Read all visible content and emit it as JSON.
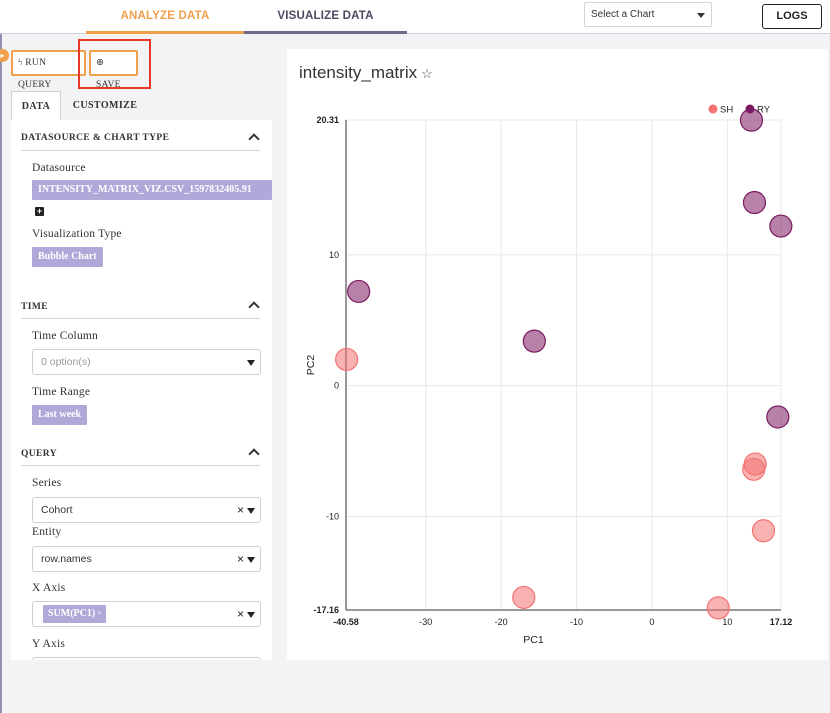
{
  "header": {
    "tabs": [
      {
        "label": "ANALYZE DATA",
        "active": true
      },
      {
        "label": "VISUALIZE DATA",
        "active": false
      }
    ],
    "chart_select": {
      "value": "Select a Chart"
    },
    "logs_label": "LOGS"
  },
  "toolbar": {
    "run_query_label": "RUN QUERY",
    "save_label": "SAVE"
  },
  "panel_tabs": [
    {
      "label": "DATA",
      "active": true
    },
    {
      "label": "CUSTOMIZE",
      "active": false
    }
  ],
  "sections": {
    "datasource": {
      "title": "DATASOURCE & CHART TYPE",
      "datasource_label": "Datasource",
      "datasource_value": "INTENSITY_MATRIX_VIZ.CSV_1597832405.91",
      "viz_type_label": "Visualization Type",
      "viz_type_value": "Bubble Chart"
    },
    "time": {
      "title": "TIME",
      "time_column_label": "Time Column",
      "time_column_placeholder": "0 option(s)",
      "time_range_label": "Time Range",
      "time_range_value": "Last week"
    },
    "query": {
      "title": "QUERY",
      "series_label": "Series",
      "series_value": "Cohort",
      "entity_label": "Entity",
      "entity_value": "row.names",
      "x_axis_label": "X Axis",
      "x_axis_value": "SUM(PC1)",
      "y_axis_label": "Y Axis"
    }
  },
  "chart": {
    "title": "intensity_matrix",
    "star_icon": "☆"
  },
  "colors": {
    "accent": "#f0a04b",
    "pill": "#b0a8d8",
    "highlight": "#e8372a",
    "series_sh": "#f47272",
    "series_ry": "#7b1a60"
  },
  "chart_data": {
    "type": "scatter",
    "title": "intensity_matrix",
    "xlabel": "PC1",
    "ylabel": "PC2",
    "xlim": [
      -40.58,
      17.12
    ],
    "ylim": [
      -17.16,
      20.31
    ],
    "x_ticks": [
      "-40.58",
      "-30",
      "-20",
      "-10",
      "0",
      "10",
      "17.12"
    ],
    "y_ticks": [
      "20.31",
      "10",
      "0",
      "-10",
      "-17.16"
    ],
    "legend_position": "top-right",
    "grid": true,
    "series": [
      {
        "name": "SH",
        "color": "#f47272",
        "points": [
          {
            "x": -40.5,
            "y": 2.0
          },
          {
            "x": -17.0,
            "y": -16.2
          },
          {
            "x": 8.8,
            "y": -17.0
          },
          {
            "x": 13.7,
            "y": -6.0
          },
          {
            "x": 13.5,
            "y": -6.4
          },
          {
            "x": 14.8,
            "y": -11.1
          }
        ]
      },
      {
        "name": "RY",
        "color": "#7b1a60",
        "points": [
          {
            "x": -38.9,
            "y": 7.2
          },
          {
            "x": -15.6,
            "y": 3.4
          },
          {
            "x": 13.2,
            "y": 20.3
          },
          {
            "x": 13.6,
            "y": 14.0
          },
          {
            "x": 17.1,
            "y": 12.2
          },
          {
            "x": 16.7,
            "y": -2.4
          }
        ]
      }
    ]
  }
}
